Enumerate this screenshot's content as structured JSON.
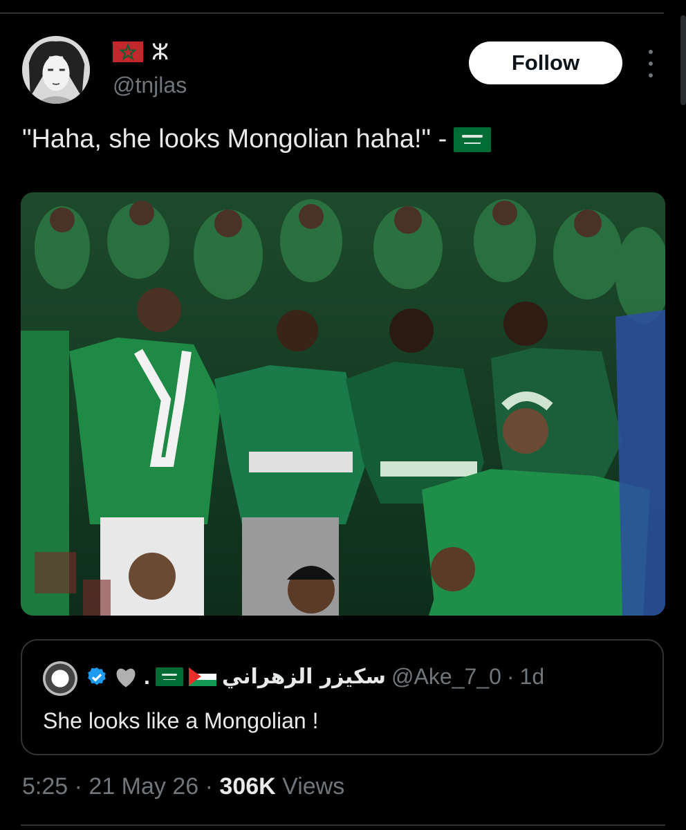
{
  "tweet": {
    "author_handle": "@tnjlas",
    "author_flag_icon": "morocco-flag-icon",
    "author_symbol": "ⵣ",
    "follow_label": "Follow",
    "text": "\"Haha, she looks Mongolian haha!\" -",
    "text_flag_icon": "saudi-flag-icon",
    "image": "photo of Saudi football fans in green jerseys saluting in a stadium"
  },
  "quoted_tweet": {
    "name": "سكيزر الزهراني",
    "name_dot": ".",
    "handle": "@Ake_7_0",
    "separator": "·",
    "time": "1d",
    "text": "She looks like a Mongolian !"
  },
  "meta": {
    "time": "5:25",
    "sep1": "·",
    "date": "21 May 26",
    "sep2": "·",
    "views_count": "306K",
    "views_label": "Views"
  },
  "colors": {
    "background": "#000000",
    "text": "#e7e9ea",
    "muted": "#71767b",
    "border": "#2f3336",
    "verified": "#1d9bf0"
  }
}
